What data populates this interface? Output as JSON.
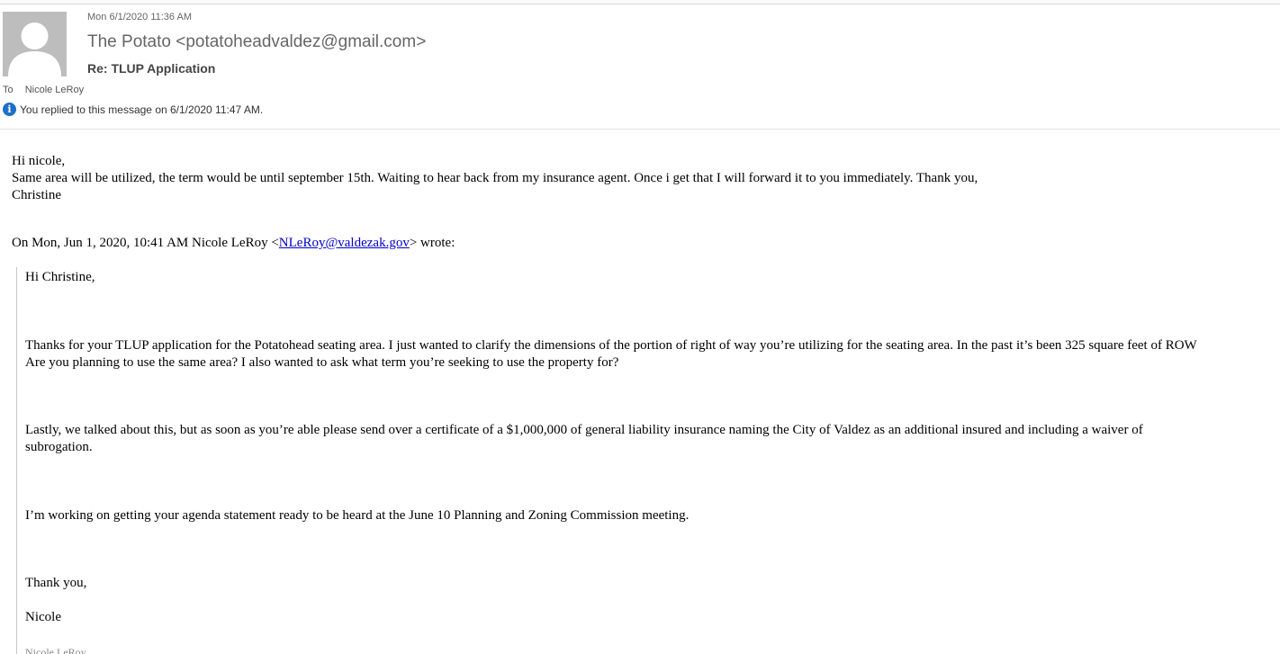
{
  "header": {
    "date": "Mon 6/1/2020 11:36 AM",
    "sender": "The Potato <potatoheadvaldez@gmail.com>",
    "subject": "Re: TLUP Application",
    "to_label": "To",
    "to_value": "Nicole LeRoy",
    "info_icon": "info-icon",
    "info_text": "You replied to this message on 6/1/2020 11:47 AM."
  },
  "body": {
    "lines": [
      "Hi nicole,",
      "Same area will be utilized, the term would be until september 15th. Waiting to hear back from my insurance agent. Once i get that I will forward it to you immediately. Thank you,",
      "Christine"
    ]
  },
  "quote_header": {
    "prefix": "On Mon, Jun 1, 2020, 10:41 AM Nicole LeRoy <",
    "email": "NLeRoy@valdezak.gov",
    "suffix": "> wrote:"
  },
  "quote": {
    "greeting": "Hi Christine,",
    "para1_line1": "Thanks for your TLUP application for the Potatohead seating area. I just wanted to clarify the dimensions of the portion of right of way you’re utilizing for the seating area. In the past it’s been 325 square feet of ROW",
    "para1_line2": "Are you planning to use the same area? I also wanted to ask what term you’re seeking to use the property for?",
    "para2_line1": "Lastly, we talked about this, but as soon as you’re able please send over a certificate of a $1,000,000 of general liability insurance naming the City of Valdez as an additional insured and including a waiver of",
    "para2_line2": "subrogation.",
    "para3": "I’m working on getting your agenda statement ready to be heard at the June 10 Planning and Zoning Commission meeting.",
    "closing": "Thank you,",
    "signature": "Nicole",
    "signature_block": "Nicole LeRoy"
  },
  "colors": {
    "link": "#0000cc",
    "info_icon": "#1e6fc6",
    "avatar_bg": "#bdbdbd"
  }
}
